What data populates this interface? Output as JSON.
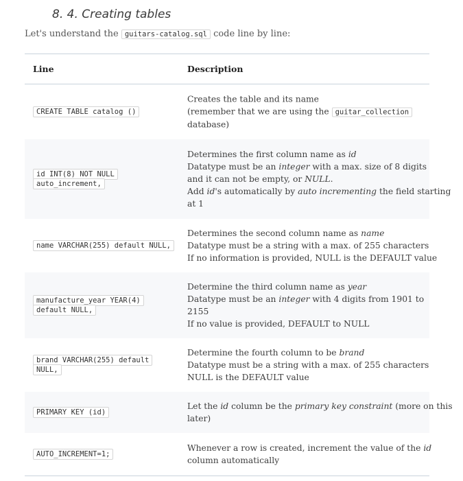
{
  "section": {
    "title": "8. 4. Creating tables"
  },
  "intro": {
    "prefix": "Let's understand the",
    "filename": "guitars-catalog.sql",
    "suffix": "code line by line:"
  },
  "table": {
    "headers": {
      "line": "Line",
      "description": "Description"
    },
    "rows": [
      {
        "code_lines": [
          "CREATE TABLE catalog ()"
        ],
        "desc": {
          "l1": "Creates the table and its name",
          "l2a": "(remember that we are using the",
          "l2code": "guitar_collection",
          "l3": "database)"
        }
      },
      {
        "code_lines": [
          "id INT(8) NOT NULL",
          "auto_increment,"
        ],
        "desc": {
          "l1a": "Determines the first column name as",
          "l1em": "id",
          "l2a": "Datatype must be an",
          "l2em": "integer",
          "l2b": "with a max. size of 8 digits",
          "l3a": "and it can not be empty, or",
          "l3em": "NULL",
          "l3b": ".",
          "l4a": "Add",
          "l4em1": "id",
          "l4b": "'s automatically by",
          "l4em2": "auto incrementing",
          "l4c": "the field starting",
          "l5": "at 1"
        }
      },
      {
        "code_lines": [
          "name VARCHAR(255) default NULL,"
        ],
        "desc": {
          "l1a": "Determines the second column name as",
          "l1em": "name",
          "l2": "Datatype must be a string with a max. of 255 characters",
          "l3": "If no information is provided, NULL is the DEFAULT value"
        }
      },
      {
        "code_lines": [
          "manufacture_year YEAR(4)",
          "default NULL,"
        ],
        "desc": {
          "l1a": "Determine the third column name as",
          "l1em": "year",
          "l2a": "Datatype must be an",
          "l2em": "integer",
          "l2b": "with 4 digits from 1901 to",
          "l3": "2155",
          "l4": "If no value is provided, DEFAULT to NULL"
        }
      },
      {
        "code_lines": [
          "brand VARCHAR(255) default",
          "NULL,"
        ],
        "desc": {
          "l1a": "Determine the fourth column to be",
          "l1em": "brand",
          "l2": "Datatype must be a string with a max. of 255 characters",
          "l3": "NULL is the DEFAULT value"
        }
      },
      {
        "code_lines": [
          "PRIMARY KEY (id)"
        ],
        "desc": {
          "l1a": "Let the",
          "l1em1": "id",
          "l1b": "column be the",
          "l1em2": "primary key constraint",
          "l1c": "(more on this",
          "l2": "later)"
        }
      },
      {
        "code_lines": [
          "AUTO_INCREMENT=1;"
        ],
        "desc": {
          "l1a": "Whenever a row is created, increment the value of the",
          "l1em": "id",
          "l2": "column automatically"
        }
      }
    ]
  }
}
